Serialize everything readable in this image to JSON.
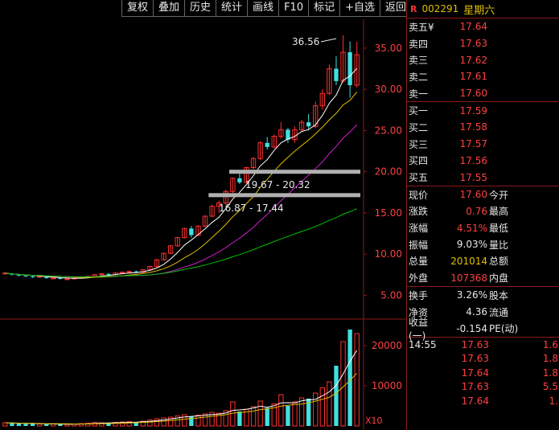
{
  "toolbar": [
    "复权",
    "叠加",
    "历史",
    "统计",
    "画线",
    "F10",
    "标记",
    "+自选",
    "返回"
  ],
  "stock": {
    "flag": "R",
    "code": "002291",
    "name": "星期六"
  },
  "asks": [
    {
      "label": "卖五¥",
      "price": "17.64"
    },
    {
      "label": "卖四",
      "price": "17.63"
    },
    {
      "label": "卖三",
      "price": "17.62"
    },
    {
      "label": "卖二",
      "price": "17.61"
    },
    {
      "label": "卖一",
      "price": "17.60"
    }
  ],
  "bids": [
    {
      "label": "买一",
      "price": "17.59"
    },
    {
      "label": "买二",
      "price": "17.58"
    },
    {
      "label": "买三",
      "price": "17.57"
    },
    {
      "label": "买四",
      "price": "17.56"
    },
    {
      "label": "买五",
      "price": "17.55"
    }
  ],
  "stats": [
    {
      "label": "现价",
      "value": "17.60",
      "label2": "今开"
    },
    {
      "label": "涨跌",
      "value": "0.76",
      "label2": "最高"
    },
    {
      "label": "涨幅",
      "value": "4.51%",
      "label2": "最低"
    },
    {
      "label": "振幅",
      "value": "9.03%",
      "label2": "量比"
    },
    {
      "label": "总量",
      "value": "201014",
      "label2": "总额"
    },
    {
      "label": "外盘",
      "value": "107368",
      "label2": "内盘"
    }
  ],
  "stats2": [
    {
      "label": "换手",
      "value": "3.26%",
      "label2": "股本"
    },
    {
      "label": "净资",
      "value": "4.36",
      "label2": "流通"
    },
    {
      "label": "收益(一)",
      "value": "-0.154",
      "label2": "PE(动)"
    }
  ],
  "ticks": [
    {
      "time": "14:55",
      "price": "17.63",
      "vol": "1.6"
    },
    {
      "time": "",
      "price": "17.63",
      "vol": "1.8"
    },
    {
      "time": "",
      "price": "17.64",
      "vol": "1.8"
    },
    {
      "time": "",
      "price": "17.63",
      "vol": "5.5"
    },
    {
      "time": "",
      "price": "17.64",
      "vol": "1."
    }
  ],
  "chart_data": {
    "type": "candlestick",
    "price_axis": {
      "ticks": [
        "35.00",
        "30.00",
        "25.00",
        "20.00",
        "15.00",
        "10.00",
        "5.00"
      ],
      "ylim": [
        2.6,
        38.4
      ]
    },
    "volume_axis": {
      "ticks": [
        "20000",
        "10000"
      ],
      "unit": "X10"
    },
    "annotations": [
      "36.56",
      "19.67 - 20.32",
      "16.87 - 17.44"
    ],
    "support_bands": [
      {
        "low": 19.67,
        "high": 20.32
      },
      {
        "low": 16.87,
        "high": 17.44
      }
    ],
    "candles": [
      [
        7.6,
        7.8,
        7.5,
        7.7
      ],
      [
        7.6,
        7.7,
        7.4,
        7.5
      ],
      [
        7.5,
        7.6,
        7.3,
        7.4
      ],
      [
        7.4,
        7.5,
        7.2,
        7.3
      ],
      [
        7.3,
        7.4,
        7.1,
        7.2
      ],
      [
        7.2,
        7.4,
        7.1,
        7.3
      ],
      [
        7.2,
        7.3,
        7.0,
        7.1
      ],
      [
        7.1,
        7.2,
        7.0,
        7.1
      ],
      [
        7.1,
        7.2,
        6.9,
        7.0
      ],
      [
        7.0,
        7.1,
        6.9,
        7.0
      ],
      [
        7.0,
        7.2,
        6.9,
        7.1
      ],
      [
        7.1,
        7.3,
        7.0,
        7.2
      ],
      [
        7.2,
        7.4,
        7.1,
        7.3
      ],
      [
        7.3,
        7.6,
        7.2,
        7.5
      ],
      [
        7.5,
        7.7,
        7.4,
        7.6
      ],
      [
        7.6,
        7.7,
        7.4,
        7.5
      ],
      [
        7.5,
        7.8,
        7.4,
        7.7
      ],
      [
        7.7,
        7.9,
        7.6,
        7.8
      ],
      [
        7.8,
        8.0,
        7.7,
        7.9
      ],
      [
        7.9,
        8.0,
        7.7,
        7.8
      ],
      [
        7.8,
        8.2,
        7.7,
        8.1
      ],
      [
        8.1,
        8.6,
        8.0,
        8.5
      ],
      [
        8.5,
        9.4,
        8.4,
        9.3
      ],
      [
        9.3,
        10.2,
        9.2,
        10.1
      ],
      [
        10.1,
        11.1,
        10.0,
        11.0
      ],
      [
        11.0,
        12.1,
        10.9,
        12.0
      ],
      [
        12.0,
        13.2,
        11.9,
        13.1
      ],
      [
        13.1,
        13.4,
        12.0,
        12.3
      ],
      [
        12.3,
        13.5,
        12.2,
        13.4
      ],
      [
        13.4,
        14.7,
        13.3,
        14.6
      ],
      [
        14.6,
        16.0,
        14.5,
        15.8
      ],
      [
        15.8,
        16.5,
        15.0,
        16.2
      ],
      [
        16.2,
        17.8,
        16.0,
        17.6
      ],
      [
        17.6,
        19.3,
        17.4,
        19.2
      ],
      [
        19.2,
        19.9,
        18.5,
        18.7
      ],
      [
        18.7,
        20.6,
        18.5,
        20.5
      ],
      [
        20.5,
        21.8,
        20.3,
        21.6
      ],
      [
        21.6,
        23.7,
        21.4,
        23.5
      ],
      [
        23.5,
        24.2,
        22.7,
        23.0
      ],
      [
        23.0,
        24.5,
        22.8,
        24.3
      ],
      [
        24.3,
        26.0,
        24.0,
        25.1
      ],
      [
        25.1,
        25.3,
        23.5,
        23.9
      ],
      [
        23.9,
        25.5,
        23.5,
        25.1
      ],
      [
        25.1,
        26.3,
        24.9,
        26.0
      ],
      [
        26.0,
        27.0,
        25.0,
        25.5
      ],
      [
        25.5,
        28.5,
        25.3,
        28.0
      ],
      [
        28.0,
        30.0,
        27.5,
        29.5
      ],
      [
        29.5,
        33.0,
        29.3,
        32.5
      ],
      [
        32.5,
        34.0,
        30.5,
        31.0
      ],
      [
        31.0,
        36.56,
        30.8,
        34.5
      ],
      [
        34.5,
        35.8,
        29.0,
        30.5
      ],
      [
        30.5,
        35.8,
        30.2,
        34.2
      ]
    ],
    "volume": [
      8,
      7,
      6,
      5,
      6,
      5,
      4,
      5,
      4,
      4,
      5,
      6,
      7,
      9,
      8,
      7,
      9,
      10,
      11,
      10,
      12,
      15,
      18,
      20,
      22,
      25,
      28,
      24,
      27,
      30,
      34,
      32,
      38,
      60,
      36,
      42,
      48,
      62,
      45,
      55,
      78,
      50,
      60,
      70,
      68,
      82,
      95,
      110,
      150,
      210,
      240,
      230
    ]
  }
}
